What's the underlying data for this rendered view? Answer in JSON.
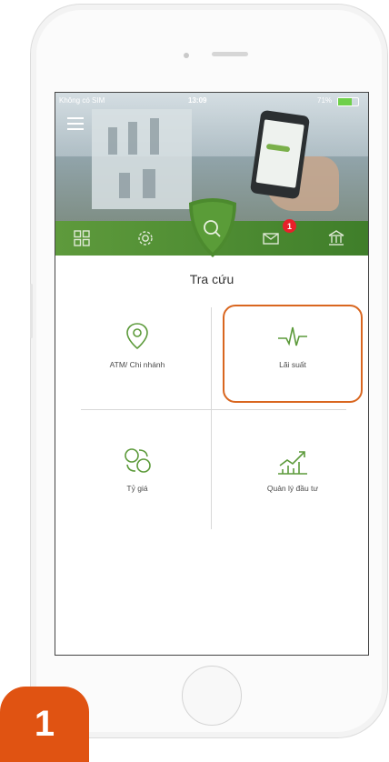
{
  "status_bar": {
    "carrier": "Không có SIM",
    "time": "13:09",
    "battery": "71%"
  },
  "tabs": [
    {
      "icon": "grid-icon"
    },
    {
      "icon": "settings-icon"
    },
    {
      "icon": "search-icon",
      "active": true
    },
    {
      "icon": "mail-icon",
      "badge": "1"
    },
    {
      "icon": "bank-icon"
    }
  ],
  "page": {
    "title": "Tra cứu"
  },
  "menu": [
    {
      "label": "ATM/ Chi nhánh",
      "icon": "map-pin-icon"
    },
    {
      "label": "Lãi suất",
      "icon": "pulse-icon",
      "highlighted": true
    },
    {
      "label": "Tỷ giá",
      "icon": "exchange-icon"
    },
    {
      "label": "Quản lý đầu tư",
      "icon": "chart-growth-icon"
    }
  ],
  "step": {
    "number": "1"
  },
  "colors": {
    "brand_green": "#4f8d33",
    "highlight_orange": "#d9661f",
    "step_orange": "#e05312",
    "badge_red": "#e8202a"
  }
}
